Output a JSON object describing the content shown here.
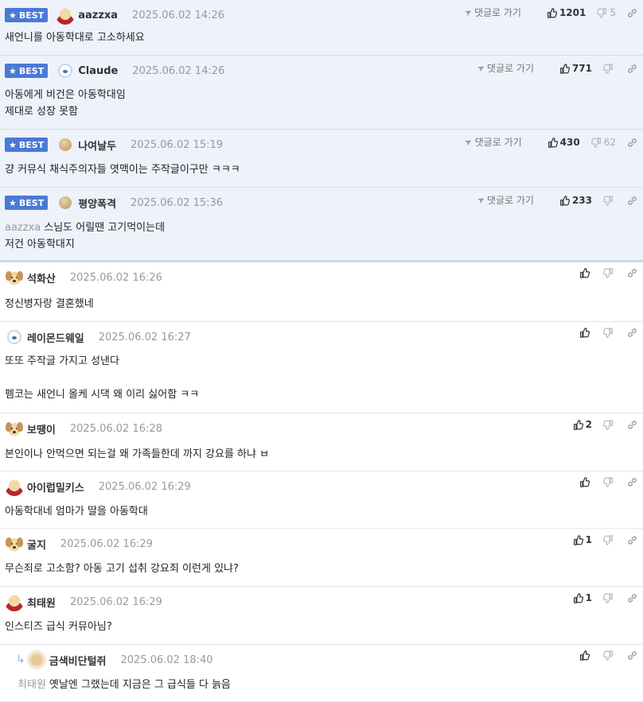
{
  "ui": {
    "best_badge": "BEST",
    "reply_link": "댓글로 가기"
  },
  "comments": [
    {
      "id": "c1",
      "best": true,
      "author": "aazzxa",
      "avatar": "red",
      "date": "2025.06.02 14:26",
      "lines": [
        "새언니를 아동학대로 고소하세요"
      ],
      "up": "1201",
      "down": "5"
    },
    {
      "id": "c2",
      "best": true,
      "author": "Claude",
      "avatar": "white",
      "date": "2025.06.02 14:26",
      "lines": [
        "아동에게 비건은 아동학대임",
        "제대로 성장 못함"
      ],
      "up": "771",
      "down": ""
    },
    {
      "id": "c3",
      "best": true,
      "author": "나여날두",
      "avatar": "ball",
      "date": "2025.06.02 15:19",
      "lines": [
        "걍 커뮤식 채식주의자들 엿맥이는 주작글이구만 ㅋㅋㅋ"
      ],
      "up": "430",
      "down": "62"
    },
    {
      "id": "c4",
      "best": true,
      "author": "평양폭격",
      "avatar": "ball",
      "date": "2025.06.02 15:36",
      "mention": "aazzxa",
      "lines": [
        "스님도 어릴땐 고기먹이는데",
        "저건 아동학대지"
      ],
      "up": "233",
      "down": ""
    },
    {
      "id": "c5",
      "best": false,
      "author": "석화산",
      "avatar": "dog",
      "date": "2025.06.02 16:26",
      "lines": [
        "정신병자랑 결혼했네"
      ],
      "up": "",
      "down": ""
    },
    {
      "id": "c6",
      "best": false,
      "author": "레이몬드웨일",
      "avatar": "white",
      "date": "2025.06.02 16:27",
      "lines": [
        "또또 주작글 가지고 성낸다",
        "",
        "펨코는 새언니 올케 시댁 왜 이리 싫어함 ㅋㅋ"
      ],
      "up": "",
      "down": ""
    },
    {
      "id": "c7",
      "best": false,
      "author": "보땡이",
      "avatar": "dog",
      "date": "2025.06.02 16:28",
      "lines": [
        "본인이나 안먹으면 되는걸 왜 가족들한데 까지 강요를 하냐 ㅂ"
      ],
      "up": "2",
      "down": ""
    },
    {
      "id": "c8",
      "best": false,
      "author": "아이럽밀키스",
      "avatar": "red",
      "date": "2025.06.02 16:29",
      "lines": [
        "아동학대네 엄마가 딸을 아동학대"
      ],
      "up": "",
      "down": ""
    },
    {
      "id": "c9",
      "best": false,
      "author": "굴지",
      "avatar": "dog",
      "date": "2025.06.02 16:29",
      "lines": [
        "무슨죄로 고소함? 아동 고기 섭취 강요죄 이런게 있냐?"
      ],
      "up": "1",
      "down": ""
    },
    {
      "id": "c10",
      "best": false,
      "author": "최태원",
      "avatar": "red",
      "date": "2025.06.02 16:29",
      "lines": [
        "인스티즈 급식 커뮤아님?"
      ],
      "up": "1",
      "down": ""
    },
    {
      "id": "c11",
      "best": false,
      "reply": true,
      "author": "금색비단털쥐",
      "avatar": "blur",
      "date": "2025.06.02 18:40",
      "mention": "최태원",
      "lines": [
        "옛날엔 그랬는데 지금은 그 급식들 다 늙음"
      ],
      "up": "",
      "down": ""
    }
  ]
}
